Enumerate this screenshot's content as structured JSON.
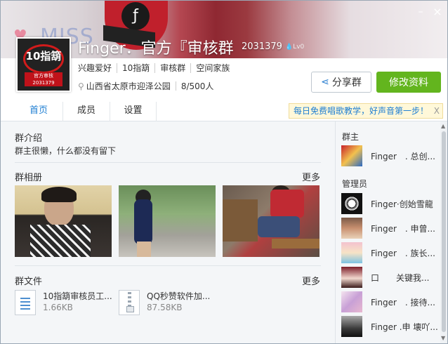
{
  "window": {
    "minimize_icon": "minimize-icon",
    "close_icon": "close-icon"
  },
  "banner": {
    "miss_text": "MISS"
  },
  "group": {
    "avatar_title": "10指箶",
    "avatar_label": "官方审核",
    "avatar_id": "2031379",
    "name": "Finger．官方『审核群",
    "id": "2031379",
    "level": "Lv0",
    "tags": [
      "兴趣爱好",
      "10指箶",
      "审核群",
      "空间家族"
    ],
    "location": "山西省太原市迎泽公园",
    "members": "8/500人"
  },
  "buttons": {
    "share": "分享群",
    "edit": "修改资料"
  },
  "tabs": [
    "首页",
    "成员",
    "设置"
  ],
  "notice": {
    "text": "每日免费唱歌教学，好声音第一步！",
    "close": "X"
  },
  "intro": {
    "title": "群介绍",
    "text": "群主很懒，什么都没有留下"
  },
  "album": {
    "title": "群相册",
    "more": "更多"
  },
  "files": {
    "title": "群文件",
    "more": "更多",
    "items": [
      {
        "name": "10指箶审核员工...",
        "size": "1.66KB",
        "icon": "document-file-icon"
      },
      {
        "name": "QQ秒赞软件加...",
        "size": "87.58KB",
        "icon": "zip-file-icon"
      }
    ]
  },
  "side": {
    "owner_title": "群主",
    "owner": {
      "name": "Finger　. 总创..."
    },
    "admin_title": "管理员",
    "admins": [
      {
        "name": "Finger·创始雪龍"
      },
      {
        "name": "Finger　. 申曾..."
      },
      {
        "name": "Finger　. 族长..."
      },
      {
        "name": "口　　关键我..."
      },
      {
        "name": "Finger　. 接待..."
      },
      {
        "name": "Finger .申 壊吖..."
      }
    ]
  },
  "colors": {
    "accent": "#1e7ed2",
    "edit_button": "#63b51e",
    "notice_bg": "#fff8d9"
  }
}
